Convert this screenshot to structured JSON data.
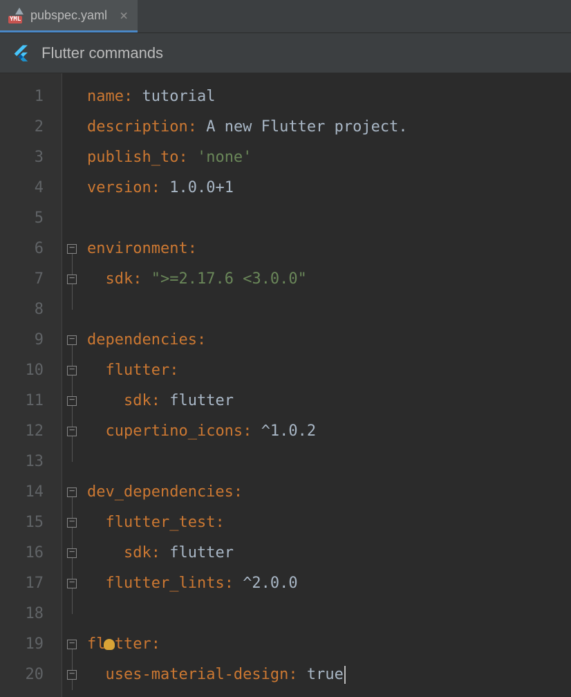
{
  "tab": {
    "icon_badge": "YML",
    "filename": "pubspec.yaml",
    "close": "×"
  },
  "banner": {
    "text": "Flutter commands"
  },
  "lines": {
    "l1": {
      "num": "1",
      "key": "name",
      "val": "tutorial"
    },
    "l2": {
      "num": "2",
      "key": "description",
      "val": "A new Flutter project."
    },
    "l3": {
      "num": "3",
      "key": "publish_to",
      "val": "'none'"
    },
    "l4": {
      "num": "4",
      "key": "version",
      "val": "1.0.0+1"
    },
    "l5": {
      "num": "5"
    },
    "l6": {
      "num": "6",
      "key": "environment"
    },
    "l7": {
      "num": "7",
      "key": "sdk",
      "val": "\">=2.17.6 <3.0.0\""
    },
    "l8": {
      "num": "8"
    },
    "l9": {
      "num": "9",
      "key": "dependencies"
    },
    "l10": {
      "num": "10",
      "key": "flutter"
    },
    "l11": {
      "num": "11",
      "key": "sdk",
      "val": "flutter"
    },
    "l12": {
      "num": "12",
      "key": "cupertino_icons",
      "val": "^1.0.2"
    },
    "l13": {
      "num": "13"
    },
    "l14": {
      "num": "14",
      "key": "dev_dependencies"
    },
    "l15": {
      "num": "15",
      "key": "flutter_test"
    },
    "l16": {
      "num": "16",
      "key": "sdk",
      "val": "flutter"
    },
    "l17": {
      "num": "17",
      "key": "flutter_lints",
      "val": "^2.0.0"
    },
    "l18": {
      "num": "18"
    },
    "l19": {
      "num": "19",
      "key": "flutter"
    },
    "l20": {
      "num": "20",
      "key": "uses-material-design",
      "val": "true"
    }
  },
  "colon": ":",
  "colon_sp": ": "
}
